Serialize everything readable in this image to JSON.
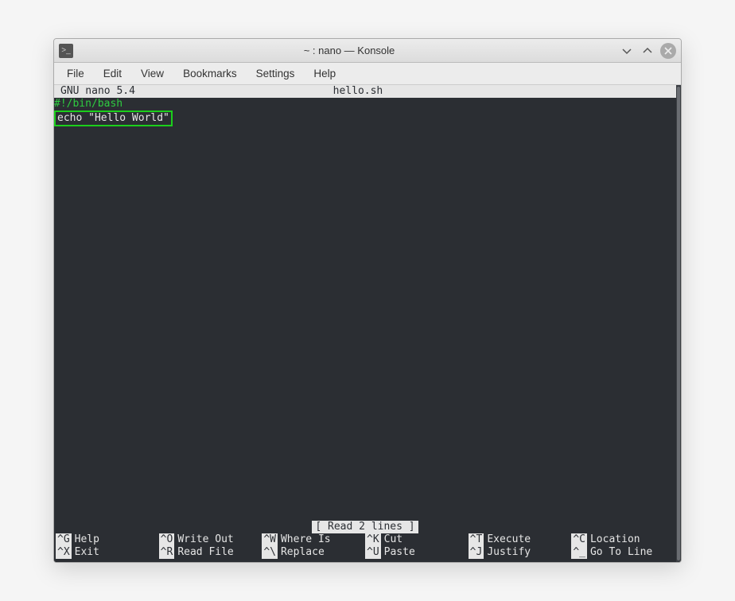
{
  "window": {
    "title": "~ : nano — Konsole"
  },
  "menubar": [
    "File",
    "Edit",
    "View",
    "Bookmarks",
    "Settings",
    "Help"
  ],
  "nano": {
    "header_left": "  GNU nano 5.4",
    "header_center": "hello.sh",
    "line1": "#!/bin/bash",
    "line2": "echo \"Hello World\"",
    "status": "[ Read 2 lines ]"
  },
  "shortcuts_row1": [
    {
      "key": "^G",
      "label": "Help"
    },
    {
      "key": "^O",
      "label": "Write Out"
    },
    {
      "key": "^W",
      "label": "Where Is"
    },
    {
      "key": "^K",
      "label": "Cut"
    },
    {
      "key": "^T",
      "label": "Execute"
    },
    {
      "key": "^C",
      "label": "Location"
    }
  ],
  "shortcuts_row2": [
    {
      "key": "^X",
      "label": "Exit"
    },
    {
      "key": "^R",
      "label": "Read File"
    },
    {
      "key": "^\\",
      "label": "Replace"
    },
    {
      "key": "^U",
      "label": "Paste"
    },
    {
      "key": "^J",
      "label": "Justify"
    },
    {
      "key": "^_",
      "label": "Go To Line"
    }
  ]
}
